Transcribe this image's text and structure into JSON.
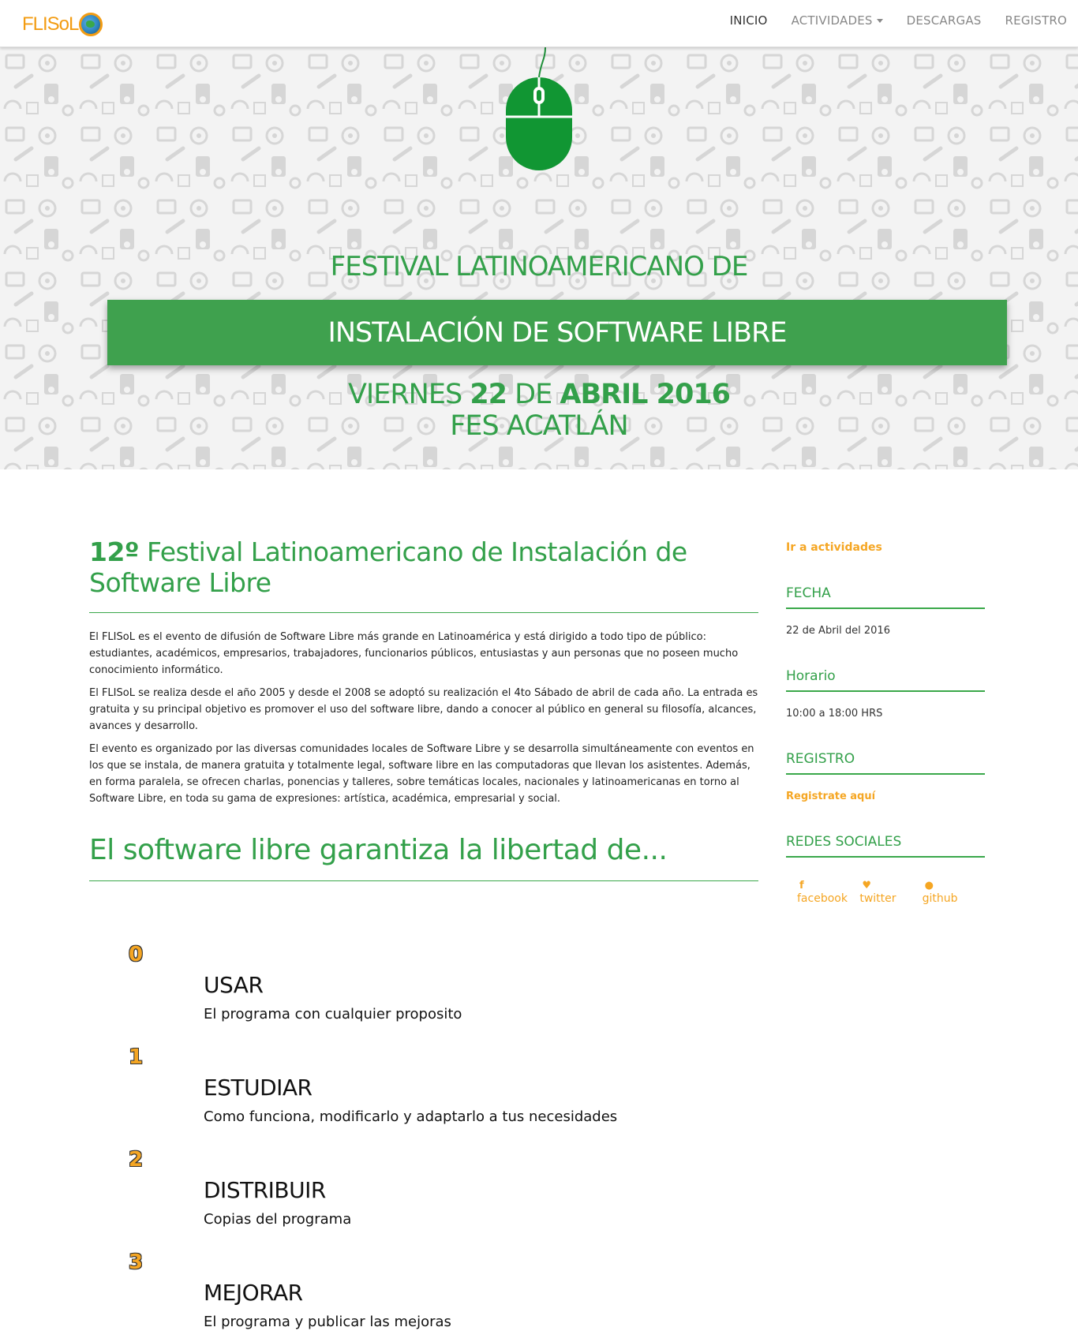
{
  "brand": {
    "name": "FLISoL"
  },
  "nav": {
    "items": [
      {
        "label": "INICIO"
      },
      {
        "label": "ACTIVIDADES"
      },
      {
        "label": "DESCARGAS"
      },
      {
        "label": "REGISTRO"
      }
    ]
  },
  "hero": {
    "line1": "FESTIVAL LATINOAMERICANO DE",
    "band": "INSTALACIÓN DE SOFTWARE LIBRE",
    "date_prefix": "VIERNES",
    "date_day": "22",
    "date_mid": "DE",
    "date_month_year": "ABRIL 2016",
    "venue": "FES ACATLÁN"
  },
  "main": {
    "title_number": "12º",
    "title_rest": "Festival Latinoamericano de Instalación de Software Libre",
    "paragraphs": [
      "El FLISoL es el evento de difusión de Software Libre más grande en Latinoamérica y está dirigido a todo tipo de público: estudiantes, académicos, empresarios, trabajadores, funcionarios públicos, entusiastas y aun personas que no poseen mucho conocimiento informático.",
      "El FLISoL se realiza desde el año 2005 y desde el 2008 se adoptó su realización el 4to Sábado de abril de cada año. La entrada es gratuita y su principal objetivo es promover el uso del software libre, dando a conocer al público en general su filosofía, alcances, avances y desarrollo.",
      "El evento es organizado por las diversas comunidades locales de Software Libre y se desarrolla simultáneamente con eventos en los que se instala, de manera gratuita y totalmente legal, software libre en las computadoras que llevan los asistentes. Además, en forma paralela, se ofrecen charlas, ponencias y talleres, sobre temáticas locales, nacionales y latinoamericanas en torno al Software Libre, en toda su gama de expresiones: artística, académica, empresarial y social."
    ],
    "subtitle": "El software libre garantiza la libertad de...",
    "freedoms": [
      {
        "num": "0",
        "title": "USAR",
        "desc": "El programa con cualquier proposito"
      },
      {
        "num": "1",
        "title": "ESTUDIAR",
        "desc": "Como funciona, modificarlo y adaptarlo a tus necesidades"
      },
      {
        "num": "2",
        "title": "DISTRIBUIR",
        "desc": "Copias del programa"
      },
      {
        "num": "3",
        "title": "MEJORAR",
        "desc": "El programa y publicar las mejoras"
      }
    ]
  },
  "sidebar": {
    "activities_link": "Ir a actividades",
    "fecha_heading": "FECHA",
    "fecha_value": "22 de Abril del 2016",
    "horario_heading": "Horario",
    "horario_value": "10:00 a 18:00 HRS",
    "registro_heading": "REGISTRO",
    "registro_link": "Registrate aquí",
    "redes_heading": "REDES SOCIALES",
    "social": [
      {
        "icon": "facebook-icon",
        "glyph": "f",
        "label": "facebook"
      },
      {
        "icon": "twitter-icon",
        "glyph": "♥",
        "label": "twitter"
      },
      {
        "icon": "github-icon",
        "glyph": "●",
        "label": "github"
      }
    ]
  },
  "colors": {
    "green": "#33a04a",
    "band": "#3fa14e",
    "orange": "#f5a623"
  }
}
